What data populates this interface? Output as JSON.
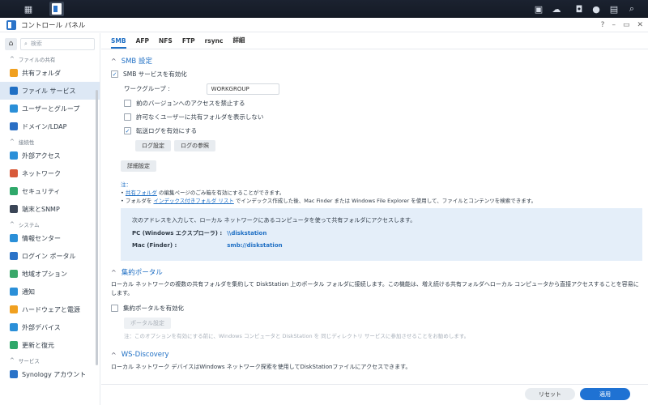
{
  "window": {
    "title": "コントロール パネル",
    "controls": [
      "?",
      "–",
      "▭",
      "✕"
    ]
  },
  "sidebar": {
    "search_placeholder": "検索",
    "sections": [
      {
        "header": "ファイルの共有",
        "items": [
          "共有フォルダ",
          "ファイル サービス",
          "ユーザーとグループ",
          "ドメイン/LDAP"
        ]
      },
      {
        "header": "接続性",
        "items": [
          "外部アクセス",
          "ネットワーク",
          "セキュリティ",
          "端末とSNMP"
        ]
      },
      {
        "header": "システム",
        "items": [
          "情報センター",
          "ログイン ポータル",
          "地域オプション",
          "通知",
          "ハードウェアと電源",
          "外部デバイス",
          "更新と復元"
        ]
      },
      {
        "header": "サービス",
        "items": [
          "Synology アカウント"
        ]
      }
    ],
    "active_item": "ファイル サービス",
    "icon_colors": [
      "#f0a020",
      "#1f6fc4",
      "#2a8fd8",
      "#2a6fc4",
      "#2a8fd8",
      "#d85a3a",
      "#2fa86a",
      "#3a4556",
      "#2a8fd8",
      "#2a73c8",
      "#3aa86a",
      "#2a8fd8",
      "#f0a020",
      "#2a8fd8",
      "#2fa86a",
      "#2a73c8"
    ]
  },
  "tabs": [
    "SMB",
    "AFP",
    "NFS",
    "FTP",
    "rsync",
    "詳細"
  ],
  "smb": {
    "title": "SMB 設定",
    "enable": "SMB サービスを有効化",
    "workgroup_label": "ワークグループ :",
    "workgroup_value": "WORKGROUP",
    "hide_prev": "前のバージョンへのアクセスを禁止する",
    "hide_unauth": "許可なくユーザーに共有フォルダを表示しない",
    "transfer_log": "転送ログを有効にする",
    "log_settings": "ログ設定",
    "log_view": "ログの参照",
    "advanced": "詳細設定",
    "note_label": "注：",
    "note1_link": "共有フォルダ",
    "note1_text": " の編集ページのごみ箱を有効にすることができます。",
    "note2_pre": "フォルダを ",
    "note2_link": "インデックス付きフォルダ リスト",
    "note2_text": " でインデックス作成した後、Mac Finder または Windows File Explorer を使用して、ファイルとコンテンツを検索できます。",
    "info_intro": "次のアドレスを入力して、ローカル ネットワークにあるコンピュータを使って共有フォルダにアクセスします。",
    "pc_label": "PC (Windows エクスプローラ) :",
    "pc_value": "\\\\diskstation",
    "mac_label": "Mac (Finder) :",
    "mac_value": "smb://diskstation"
  },
  "portal": {
    "title": "集約ポータル",
    "desc": "ローカル ネットワークの複数の共有フォルダを集約して DiskStation 上のポータル フォルダに接続します。この機能は、増え続ける共有フォルダへローカル コンピュータから直接アクセスすることを容易にします。",
    "enable": "集約ポータルを有効化",
    "settings": "ポータル設定",
    "note": "注：このオプションを有効にする前に、Windows コンピュータと DiskStation を 同じディレクトリ サービスに参加させることをお勧めします。"
  },
  "ws": {
    "title": "WS-Discovery",
    "desc": "ローカル ネットワーク デバイスはWindows ネットワーク探索を使用してDiskStationファイルにアクセスできます。"
  },
  "footer": {
    "reset": "リセット",
    "apply": "適用"
  }
}
